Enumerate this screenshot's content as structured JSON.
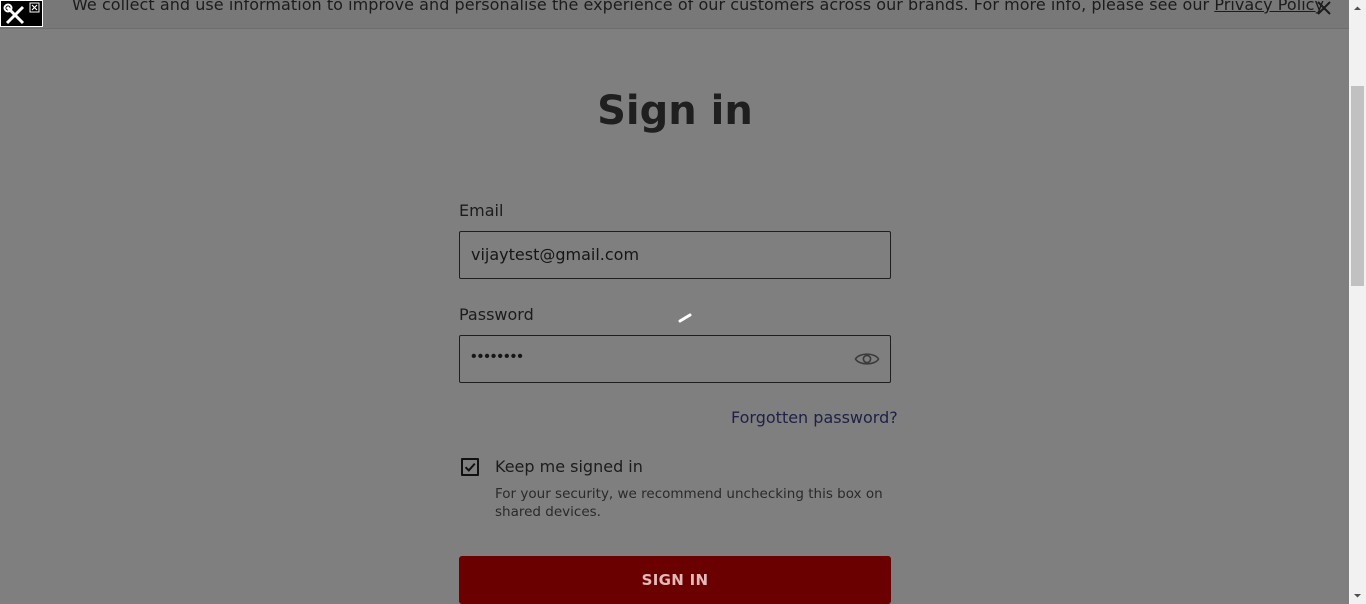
{
  "banner": {
    "text": "We collect and use information to improve and personalise the experience of our customers across our brands. For more info, please see our ",
    "link": "Privacy Policy",
    "suffix": "."
  },
  "form": {
    "title": "Sign in",
    "email_label": "Email",
    "email_value": "vijaytest@gmail.com",
    "password_label": "Password",
    "password_value": "••••••••",
    "forgot_link": "Forgotten password?",
    "keep_signed_in_label": "Keep me signed in",
    "keep_signed_in_checked": true,
    "security_hint": "For your security, we recommend unchecking this box on shared devices.",
    "submit_label": "SIGN IN"
  },
  "colors": {
    "overlay": "#7f7f7f",
    "submit_bg": "#6b0000",
    "link": "#1e2046"
  },
  "icons": {
    "banner_close": "close-icon",
    "password_toggle": "eye-icon",
    "checkbox": "checkmark-icon",
    "tools": "tools-icon"
  }
}
